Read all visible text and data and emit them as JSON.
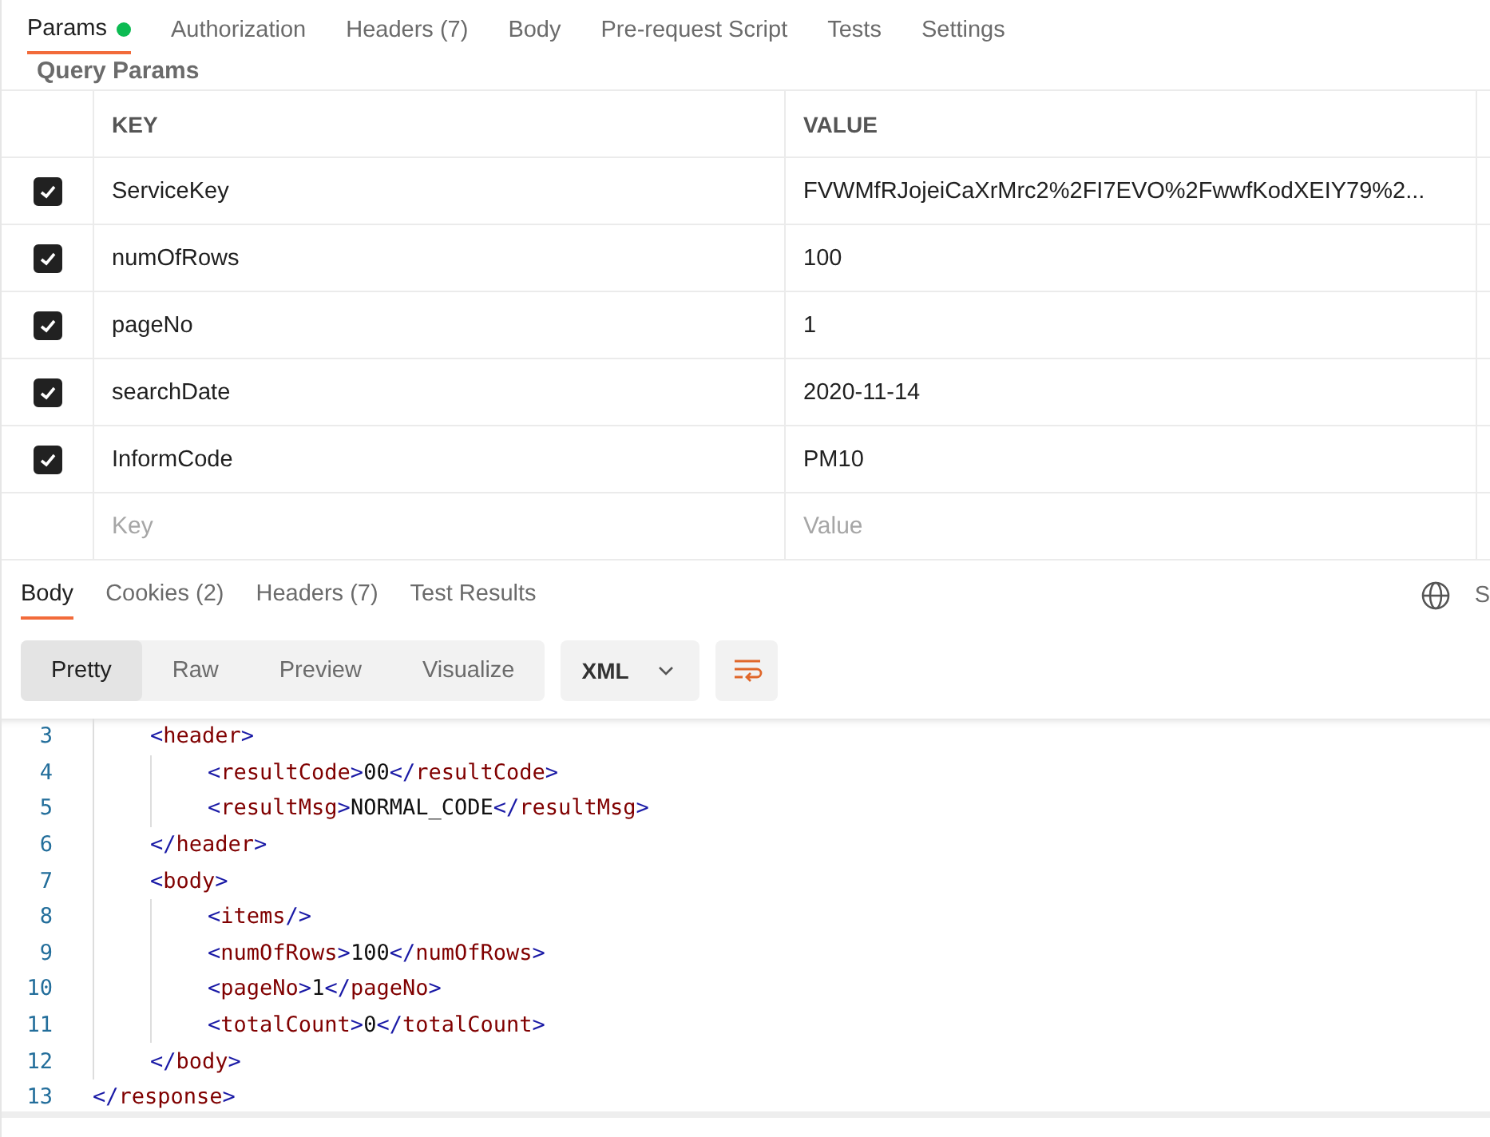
{
  "request_tabs": [
    {
      "label": "Params",
      "dot": true,
      "selected": true
    },
    {
      "label": "Authorization",
      "dot": false,
      "selected": false
    },
    {
      "label": "Headers",
      "count": "(7)",
      "dot": false,
      "selected": false
    },
    {
      "label": "Body",
      "dot": false,
      "selected": false
    },
    {
      "label": "Pre-request Script",
      "dot": false,
      "selected": false
    },
    {
      "label": "Tests",
      "dot": false,
      "selected": false
    },
    {
      "label": "Settings",
      "dot": false,
      "selected": false
    }
  ],
  "section_title": "Query Params",
  "table": {
    "columns": [
      "KEY",
      "VALUE"
    ],
    "rows": [
      {
        "checked": true,
        "key": "ServiceKey",
        "value": "FVWMfRJojeiCaXrMrc2%2FI7EVO%2FwwfKodXEIY79%2..."
      },
      {
        "checked": true,
        "key": "numOfRows",
        "value": "100"
      },
      {
        "checked": true,
        "key": "pageNo",
        "value": "1"
      },
      {
        "checked": true,
        "key": "searchDate",
        "value": "2020-11-14"
      },
      {
        "checked": true,
        "key": "InformCode",
        "value": "PM10"
      }
    ],
    "new_row": {
      "key_placeholder": "Key",
      "value_placeholder": "Value"
    }
  },
  "response_tabs": [
    {
      "label": "Body",
      "selected": true
    },
    {
      "label": "Cookies",
      "count": "(2)",
      "selected": false
    },
    {
      "label": "Headers",
      "count": "(7)",
      "selected": false
    },
    {
      "label": "Test Results",
      "selected": false
    }
  ],
  "response_cut_label": "S",
  "view_modes": [
    {
      "label": "Pretty",
      "selected": true
    },
    {
      "label": "Raw",
      "selected": false
    },
    {
      "label": "Preview",
      "selected": false
    },
    {
      "label": "Visualize",
      "selected": false
    }
  ],
  "format_select": "XML",
  "code_lines": [
    {
      "number": "3",
      "text": "    <header>"
    },
    {
      "number": "4",
      "text": "        <resultCode>00</resultCode>"
    },
    {
      "number": "5",
      "text": "        <resultMsg>NORMAL_CODE</resultMsg>"
    },
    {
      "number": "6",
      "text": "    </header>"
    },
    {
      "number": "7",
      "text": "    <body>"
    },
    {
      "number": "8",
      "text": "        <items/>"
    },
    {
      "number": "9",
      "text": "        <numOfRows>100</numOfRows>"
    },
    {
      "number": "10",
      "text": "        <pageNo>1</pageNo>"
    },
    {
      "number": "11",
      "text": "        <totalCount>0</totalCount>"
    },
    {
      "number": "12",
      "text": "    </body>"
    },
    {
      "number": "13",
      "text": "</response>"
    }
  ]
}
